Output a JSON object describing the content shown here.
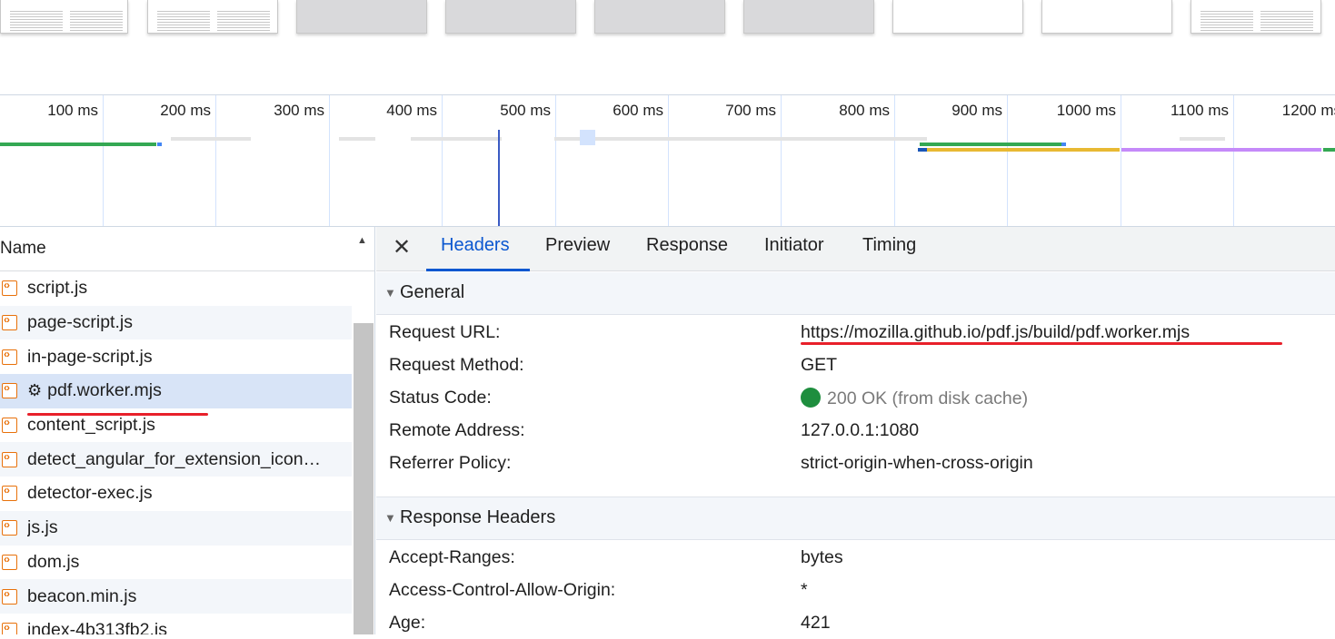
{
  "timeline": {
    "ticks": [
      "100 ms",
      "200 ms",
      "300 ms",
      "400 ms",
      "500 ms",
      "600 ms",
      "700 ms",
      "800 ms",
      "900 ms",
      "1000 ms",
      "1100 ms",
      "1200 ms"
    ]
  },
  "request_list": {
    "column_header": "Name",
    "rows": [
      {
        "name": "script.js",
        "selected": false,
        "gear": false
      },
      {
        "name": "page-script.js",
        "selected": false,
        "gear": false
      },
      {
        "name": "in-page-script.js",
        "selected": false,
        "gear": false
      },
      {
        "name": "pdf.worker.mjs",
        "selected": true,
        "gear": true,
        "gear_glyph": "⚙"
      },
      {
        "name": "content_script.js",
        "selected": false,
        "gear": false
      },
      {
        "name": "detect_angular_for_extension_icon…",
        "selected": false,
        "gear": false
      },
      {
        "name": "detector-exec.js",
        "selected": false,
        "gear": false
      },
      {
        "name": "js.js",
        "selected": false,
        "gear": false
      },
      {
        "name": "dom.js",
        "selected": false,
        "gear": false
      },
      {
        "name": "beacon.min.js",
        "selected": false,
        "gear": false
      },
      {
        "name": "index-4b313fb2.js",
        "selected": false,
        "gear": false
      }
    ]
  },
  "details": {
    "close_glyph": "✕",
    "tabs": [
      "Headers",
      "Preview",
      "Response",
      "Initiator",
      "Timing"
    ],
    "active_tab": "Headers",
    "general": {
      "title": "General",
      "rows": [
        {
          "key": "Request URL:",
          "value": "https://mozilla.github.io/pdf.js/build/pdf.worker.mjs"
        },
        {
          "key": "Request Method:",
          "value": "GET"
        },
        {
          "key": "Status Code:",
          "value": "200 OK (from disk cache)"
        },
        {
          "key": "Remote Address:",
          "value": "127.0.0.1:1080"
        },
        {
          "key": "Referrer Policy:",
          "value": "strict-origin-when-cross-origin"
        }
      ]
    },
    "response_headers": {
      "title": "Response Headers",
      "rows": [
        {
          "key": "Accept-Ranges:",
          "value": "bytes"
        },
        {
          "key": "Access-Control-Allow-Origin:",
          "value": "*"
        },
        {
          "key": "Age:",
          "value": "421"
        }
      ]
    }
  },
  "colors": {
    "accent": "#0b57d0",
    "status_ok": "#1e8e3e",
    "annotation_red": "#e8202a",
    "file_icon": "#e8710a"
  }
}
